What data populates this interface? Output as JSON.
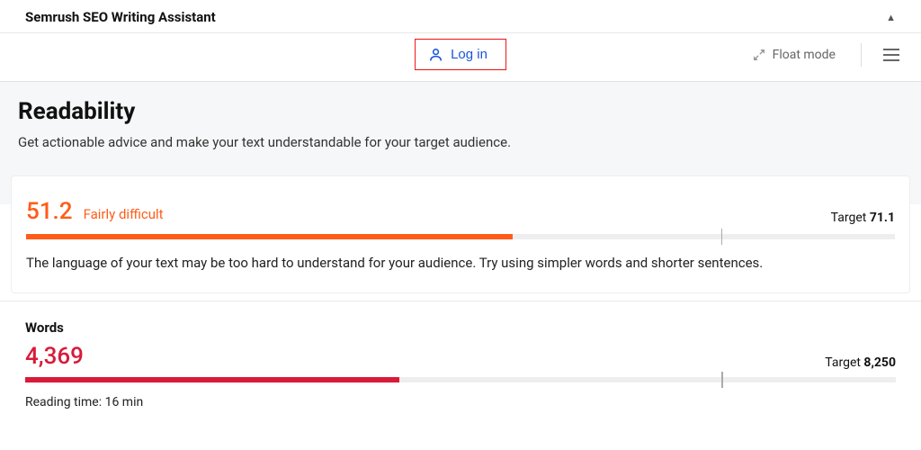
{
  "header": {
    "title": "Semrush SEO Writing Assistant"
  },
  "toolbar": {
    "login_label": "Log in",
    "float_label": "Float mode"
  },
  "readability": {
    "title": "Readability",
    "subtitle": "Get actionable advice and make your text understandable for your target audience.",
    "score_value": "51.2",
    "score_label": "Fairly difficult",
    "target_prefix": "Target ",
    "target_value": "71.1",
    "bar_color": "#ff5c1a",
    "bar_pct": "56%",
    "target_tick_pct": "80%",
    "advice": "The language of your text may be too hard to understand for your audience. Try using simpler words and shorter sentences."
  },
  "words": {
    "title": "Words",
    "count": "4,369",
    "target_prefix": "Target ",
    "target_value": "8,250",
    "bar_color": "#d81b3a",
    "bar_pct": "43%",
    "target_tick_pct": "80%",
    "reading_time": "Reading time: 16 min"
  }
}
